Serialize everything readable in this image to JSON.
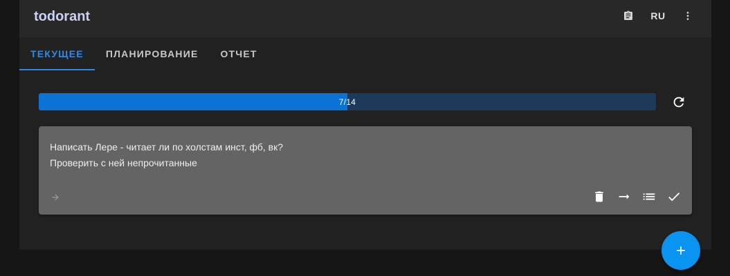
{
  "app": {
    "logo_text": "todorant",
    "logo_colors": {
      "text": "#c9d2f5",
      "accent": "#ff5fa0"
    }
  },
  "appbar": {
    "clipboard_icon": "clipboard-icon",
    "language_label": "RU",
    "menu_icon": "more-vert-icon"
  },
  "tabs": [
    {
      "label": "ТЕКУЩЕЕ",
      "active": true
    },
    {
      "label": "ПЛАНИРОВАНИЕ",
      "active": false
    },
    {
      "label": "ОТЧЕТ",
      "active": false
    }
  ],
  "progress": {
    "completed": 7,
    "total": 14,
    "label": "7/14",
    "fill_color": "#0b72d6",
    "track_color": "#1d3a5c"
  },
  "refresh_icon": "refresh-icon",
  "todo_card": {
    "lines": [
      "Написать Лере - читает ли по холстам инст, фб, вк?",
      "Проверить с ней непрочитанные"
    ],
    "footer_icon": "arrow-right-icon",
    "actions": [
      {
        "name": "delete-button",
        "icon": "trash-icon"
      },
      {
        "name": "skip-button",
        "icon": "long-arrow-right-icon"
      },
      {
        "name": "breakdown-button",
        "icon": "list-icon"
      },
      {
        "name": "done-button",
        "icon": "check-icon"
      }
    ]
  },
  "fab": {
    "icon": "plus-icon",
    "color": "#0a94f2"
  },
  "colors": {
    "accent": "#2f89e5",
    "background": "#161616",
    "surface": "#212121",
    "appbar": "#282828",
    "card": "#646464"
  }
}
